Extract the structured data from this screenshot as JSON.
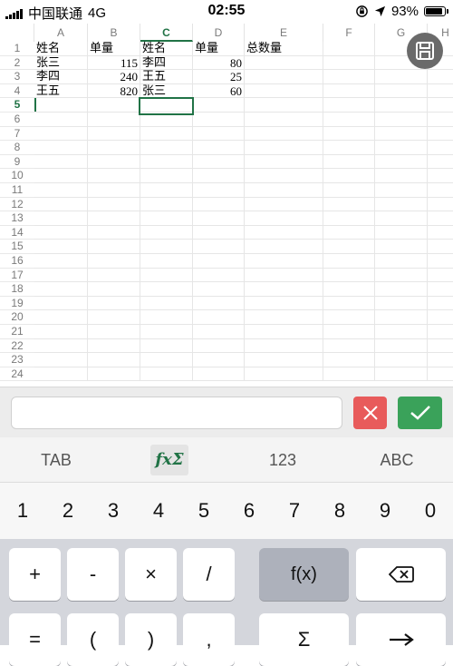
{
  "status_bar": {
    "carrier": "中国联通",
    "network": "4G",
    "time": "02:55",
    "battery": "93%",
    "battery_level": 0.93
  },
  "sheet": {
    "columns": [
      "A",
      "B",
      "C",
      "D",
      "E",
      "F",
      "G",
      "H"
    ],
    "active_column": "C",
    "rows": [
      "1",
      "2",
      "3",
      "4",
      "5",
      "6",
      "7",
      "8",
      "9",
      "10",
      "11",
      "12",
      "13",
      "14",
      "15",
      "16",
      "17",
      "18",
      "19",
      "20",
      "21",
      "22",
      "23",
      "24"
    ],
    "active_row": "5",
    "cells": [
      {
        "ref": "A1",
        "value": "姓名",
        "col": 0,
        "row": 0,
        "type": "txt"
      },
      {
        "ref": "B1",
        "value": "单量",
        "col": 1,
        "row": 0,
        "type": "txt"
      },
      {
        "ref": "C1",
        "value": "姓名",
        "col": 2,
        "row": 0,
        "type": "txt"
      },
      {
        "ref": "D1",
        "value": "单量",
        "col": 3,
        "row": 0,
        "type": "txt"
      },
      {
        "ref": "E1",
        "value": "总数量",
        "col": 4,
        "row": 0,
        "type": "txt"
      },
      {
        "ref": "A2",
        "value": "张三",
        "col": 0,
        "row": 1,
        "type": "txt"
      },
      {
        "ref": "B2",
        "value": "115",
        "col": 1,
        "row": 1,
        "type": "num"
      },
      {
        "ref": "C2",
        "value": "李四",
        "col": 2,
        "row": 1,
        "type": "txt"
      },
      {
        "ref": "D2",
        "value": "80",
        "col": 3,
        "row": 1,
        "type": "num"
      },
      {
        "ref": "A3",
        "value": "李四",
        "col": 0,
        "row": 2,
        "type": "txt"
      },
      {
        "ref": "B3",
        "value": "240",
        "col": 1,
        "row": 2,
        "type": "num"
      },
      {
        "ref": "C3",
        "value": "王五",
        "col": 2,
        "row": 2,
        "type": "txt"
      },
      {
        "ref": "D3",
        "value": "25",
        "col": 3,
        "row": 2,
        "type": "num"
      },
      {
        "ref": "A4",
        "value": "王五",
        "col": 0,
        "row": 3,
        "type": "txt"
      },
      {
        "ref": "B4",
        "value": "820",
        "col": 1,
        "row": 3,
        "type": "num"
      },
      {
        "ref": "C4",
        "value": "张三",
        "col": 2,
        "row": 3,
        "type": "txt"
      },
      {
        "ref": "D4",
        "value": "60",
        "col": 3,
        "row": 3,
        "type": "num"
      }
    ]
  },
  "formula_bar": {
    "value": ""
  },
  "modes": [
    {
      "label": "TAB"
    },
    {
      "label": "fxΣ"
    },
    {
      "label": "123"
    },
    {
      "label": "ABC"
    }
  ],
  "digits": [
    "1",
    "2",
    "3",
    "4",
    "5",
    "6",
    "7",
    "8",
    "9",
    "0"
  ],
  "keys_row1": [
    {
      "label": "+"
    },
    {
      "label": "-"
    },
    {
      "label": "×"
    },
    {
      "label": "/"
    },
    {
      "label": "f(x)"
    }
  ],
  "keys_row2": [
    {
      "label": "="
    },
    {
      "label": "("
    },
    {
      "label": ")"
    },
    {
      "label": ","
    },
    {
      "label": "Σ"
    }
  ],
  "colors": {
    "accent": "#217346",
    "cancel": "#e85b5b",
    "confirm": "#3aa25a",
    "save": "#6a6a6a"
  }
}
